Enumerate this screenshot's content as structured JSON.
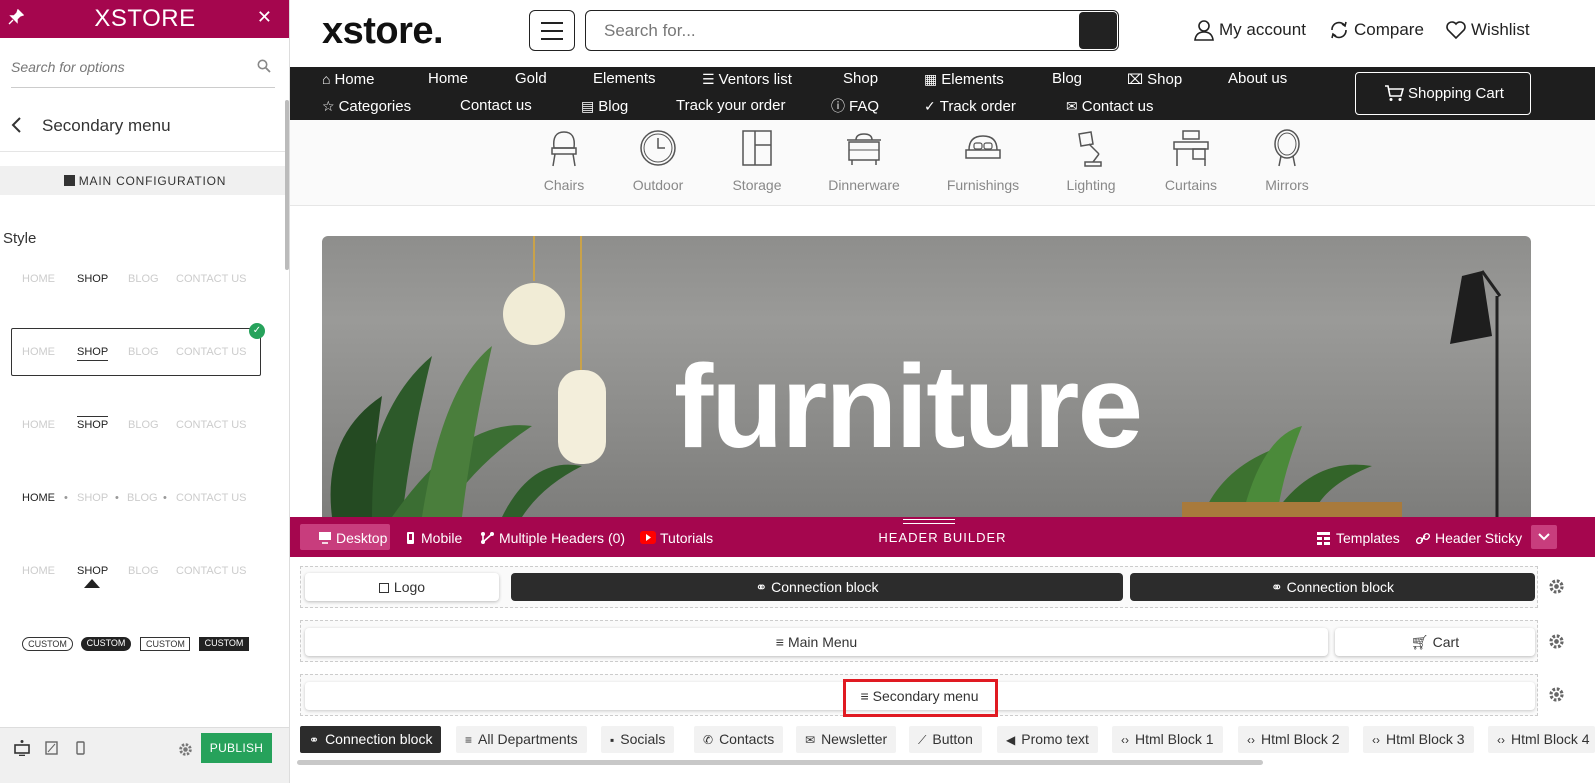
{
  "panel": {
    "brand": "XSTORE",
    "search_placeholder": "Search for options",
    "section_title": "Secondary menu",
    "main_config_label": "MAIN CONFIGURATION",
    "style_label": "Style",
    "style_items": [
      "HOME",
      "SHOP",
      "BLOG",
      "CONTACT US"
    ],
    "custom_label": "CUSTOM",
    "publish_label": "PUBLISH"
  },
  "site": {
    "logo": "xstore.",
    "search_placeholder": "Search for...",
    "account": {
      "my_account": "My account",
      "compare": "Compare",
      "wishlist": "Wishlist"
    },
    "nav_row1": [
      "Home",
      "Home",
      "Gold",
      "Elements",
      "Ventors list",
      "Shop",
      "Elements",
      "Blog",
      "Shop",
      "About us"
    ],
    "nav_row2": [
      "Categories",
      "Contact us",
      "Blog",
      "Track your order",
      "FAQ",
      "Track order",
      "Contact us"
    ],
    "cart_label": "Shopping Cart",
    "categories": [
      "Chairs",
      "Outdoor",
      "Storage",
      "Dinnerware",
      "Furnishings",
      "Lighting",
      "Curtains",
      "Mirrors"
    ],
    "hero_text": "furniture"
  },
  "header_builder": {
    "title": "HEADER BUILDER",
    "desktop": "Desktop",
    "mobile": "Mobile",
    "multiple_headers": "Multiple Headers (0)",
    "tutorials": "Tutorials",
    "templates": "Templates",
    "header_sticky": "Header Sticky",
    "row1": {
      "logo": "Logo",
      "conn1": "Connection block",
      "conn2": "Connection block"
    },
    "row2": {
      "main_menu": "Main Menu",
      "cart": "Cart"
    },
    "row3": {
      "secondary_menu": "Secondary menu"
    },
    "tray": [
      "Connection block",
      "All Departments",
      "Socials",
      "Contacts",
      "Newsletter",
      "Button",
      "Promo text",
      "Html Block 1",
      "Html Block 2",
      "Html Block 3",
      "Html Block 4"
    ]
  },
  "colors": {
    "brand": "#a5064e",
    "publish": "#26a25b",
    "highlight": "#e01a22",
    "nav_bg": "#1e1e1e"
  }
}
